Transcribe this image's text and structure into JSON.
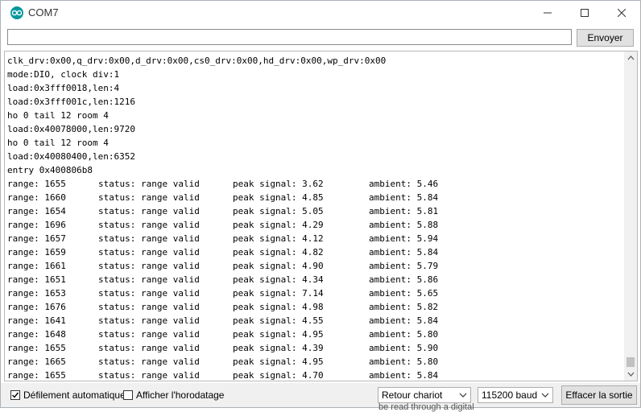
{
  "window": {
    "title": "COM7"
  },
  "send": {
    "input_value": "",
    "button_label": "Envoyer"
  },
  "output": {
    "boot_lines": [
      "clk_drv:0x00,q_drv:0x00,d_drv:0x00,cs0_drv:0x00,hd_drv:0x00,wp_drv:0x00",
      "mode:DIO, clock div:1",
      "load:0x3fff0018,len:4",
      "load:0x3fff001c,len:1216",
      "ho 0 tail 12 room 4",
      "load:0x40078000,len:9720",
      "ho 0 tail 12 room 4",
      "load:0x40080400,len:6352",
      "entry 0x400806b8"
    ],
    "readings": [
      {
        "range": "range: 1655",
        "status": "status: range valid",
        "peak": "peak signal: 3.62",
        "ambient": "ambient: 5.46"
      },
      {
        "range": "range: 1660",
        "status": "status: range valid",
        "peak": "peak signal: 4.85",
        "ambient": "ambient: 5.84"
      },
      {
        "range": "range: 1654",
        "status": "status: range valid",
        "peak": "peak signal: 5.05",
        "ambient": "ambient: 5.81"
      },
      {
        "range": "range: 1696",
        "status": "status: range valid",
        "peak": "peak signal: 4.29",
        "ambient": "ambient: 5.88"
      },
      {
        "range": "range: 1657",
        "status": "status: range valid",
        "peak": "peak signal: 4.12",
        "ambient": "ambient: 5.94"
      },
      {
        "range": "range: 1659",
        "status": "status: range valid",
        "peak": "peak signal: 4.82",
        "ambient": "ambient: 5.84"
      },
      {
        "range": "range: 1661",
        "status": "status: range valid",
        "peak": "peak signal: 4.90",
        "ambient": "ambient: 5.79"
      },
      {
        "range": "range: 1651",
        "status": "status: range valid",
        "peak": "peak signal: 4.34",
        "ambient": "ambient: 5.86"
      },
      {
        "range": "range: 1653",
        "status": "status: range valid",
        "peak": "peak signal: 7.14",
        "ambient": "ambient: 5.65"
      },
      {
        "range": "range: 1676",
        "status": "status: range valid",
        "peak": "peak signal: 4.98",
        "ambient": "ambient: 5.82"
      },
      {
        "range": "range: 1641",
        "status": "status: range valid",
        "peak": "peak signal: 4.55",
        "ambient": "ambient: 5.84"
      },
      {
        "range": "range: 1648",
        "status": "status: range valid",
        "peak": "peak signal: 4.95",
        "ambient": "ambient: 5.80"
      },
      {
        "range": "range: 1655",
        "status": "status: range valid",
        "peak": "peak signal: 4.39",
        "ambient": "ambient: 5.90"
      },
      {
        "range": "range: 1665",
        "status": "status: range valid",
        "peak": "peak signal: 4.95",
        "ambient": "ambient: 5.80"
      },
      {
        "range": "range: 1655",
        "status": "status: range valid",
        "peak": "peak signal: 4.70",
        "ambient": "ambient: 5.84"
      }
    ]
  },
  "footer": {
    "autoscroll": {
      "label": "Défilement automatique",
      "checked": true
    },
    "timestamp": {
      "label": "Afficher l'horodatage",
      "checked": false
    },
    "line_ending": {
      "selected": "Retour chariot"
    },
    "baud": {
      "selected": "115200 baud"
    },
    "clear_label": "Effacer la sortie"
  },
  "background": {
    "bleed_text": "be read through a digital"
  },
  "colors": {
    "accent": "#00979c",
    "chrome": "#f0f0f0",
    "button": "#e1e1e1"
  },
  "icons": [
    "arduino-logo-icon",
    "minimize-icon",
    "maximize-icon",
    "close-icon",
    "checkmark-icon",
    "chevron-down-icon",
    "scroll-up-icon",
    "scroll-down-icon"
  ]
}
